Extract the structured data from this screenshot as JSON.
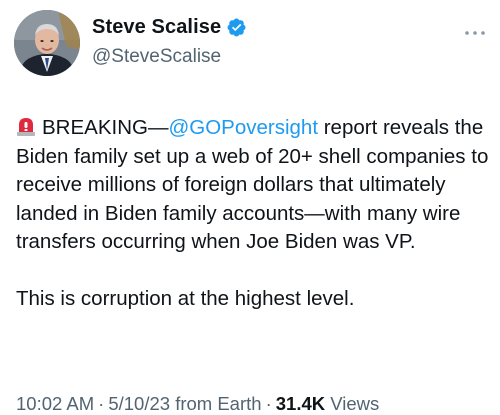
{
  "author": {
    "display_name": "Steve Scalise",
    "handle": "@SteveScalise",
    "verified": true,
    "verified_color": "#1d9bf0"
  },
  "tweet": {
    "alert_icon": "rotating-light-icon",
    "text_prefix": "BREAKING—",
    "mention": "@GOPoversight",
    "text_after_mention": " report reveals the Biden family set up a web of 20+ shell companies to receive millions of foreign dollars that ultimately landed in Biden family accounts—with many wire transfers occurring when Joe Biden was VP.",
    "second_paragraph": "This is corruption at the highest level.",
    "mention_color": "#1d9bf0"
  },
  "meta": {
    "time": "10:02 AM",
    "separator": "·",
    "date": "5/10/23 from Earth",
    "views_count": "31.4K",
    "views_label": "Views"
  },
  "icons": {
    "more": "more-horizontal-icon",
    "verified": "verified-badge-icon"
  }
}
